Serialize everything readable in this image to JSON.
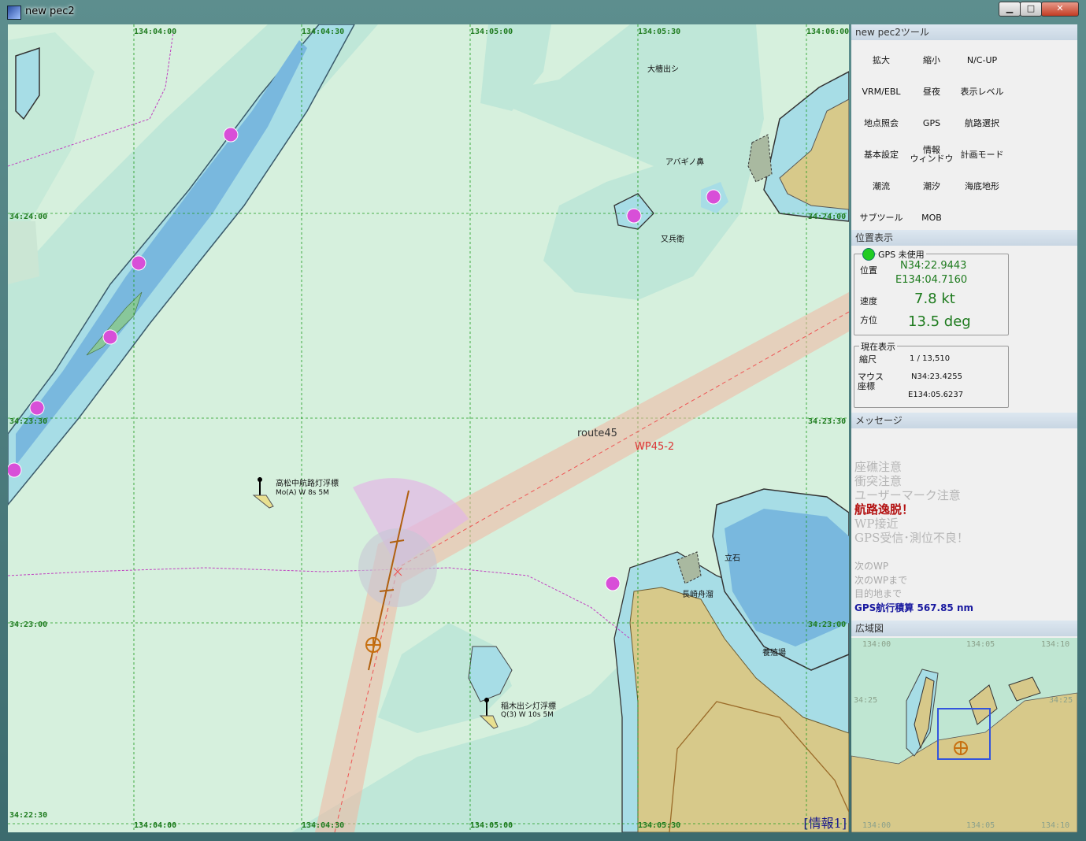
{
  "window": {
    "title": "new pec2",
    "controls": {
      "minimize": "▁",
      "maximize": "□",
      "close": "✕"
    }
  },
  "map": {
    "coords": {
      "lon_top": [
        "134:04:00",
        "134:04:30",
        "134:05:00",
        "134:05:30",
        "134:06:00"
      ],
      "lon_bottom": [
        "134:04:00",
        "134:04:30",
        "134:05:00",
        "134:05:30"
      ],
      "lat_left": [
        "34:24:00",
        "34:23:30",
        "34:23:00",
        "34:22:30"
      ],
      "lat_right": [
        "34:24:00",
        "34:23:30",
        "34:23:00"
      ]
    },
    "labels": {
      "oobishi": "大檣出シ",
      "abaginohana": "アバギノ鼻",
      "matabee": "又兵衛",
      "tateishi": "立石",
      "nagasaki_port": "長崎舟溜",
      "aquaculture": "養殖場"
    },
    "buoys": {
      "takamatsu_name": "高松中航路灯浮標",
      "takamatsu_light": "Mo(A) W 8s 5M",
      "inagi_name": "稲木出シ灯浮標",
      "inagi_light": "Q(3) W 10s 5M"
    },
    "route": {
      "name": "route45",
      "waypoint": "WP45-2"
    },
    "info_button": "[情報1]"
  },
  "panel": {
    "tools_header": "new pec2ツール",
    "tools": [
      "拡大",
      "縮小",
      "N/C-UP",
      "VRM/EBL",
      "昼夜",
      "表示レベル",
      "地点照会",
      "GPS",
      "航路選択",
      "基本設定",
      "情報\nウィンドウ",
      "計画モード",
      "潮流",
      "潮汐",
      "海底地形",
      "サブツール",
      "MOB"
    ],
    "position_header": "位置表示",
    "gps_status": "GPS 未使用",
    "gps_status_color": "#22cc22",
    "position_label": "位置",
    "lat": "N34:22.9443",
    "lon": "E134:04.7160",
    "speed_label": "速度",
    "speed": "7.8 kt",
    "heading_label": "方位",
    "heading": "13.5 deg",
    "current_legend": "現在表示",
    "scale_label": "縮尺",
    "scale": "1 / 13,510",
    "mouse_label": "マウス\n座標",
    "mouse_lat": "N34:23.4255",
    "mouse_lon": "E134:05.6237",
    "message_header": "メッセージ",
    "alerts": [
      {
        "text": "座礁注意",
        "active": false
      },
      {
        "text": "衝突注意",
        "active": false
      },
      {
        "text": "ユーザーマーク注意",
        "active": false
      },
      {
        "text": "航路逸脱！",
        "active": true
      },
      {
        "text": "WP接近",
        "active": false
      },
      {
        "text": "GPS受信･測位不良！",
        "active": false
      }
    ],
    "next_wp": "次のWP",
    "to_next_wp": "次のWPまで",
    "to_destination": "目的地まで",
    "gps_total": "GPS航行積算 567.85 nm",
    "overview_header": "広域図",
    "overview_coords": {
      "top": [
        "134:00",
        "134:05",
        "134:10"
      ],
      "bottom": [
        "134:00",
        "134:05",
        "134:10"
      ],
      "left": "34:25",
      "right": "34:25"
    }
  }
}
